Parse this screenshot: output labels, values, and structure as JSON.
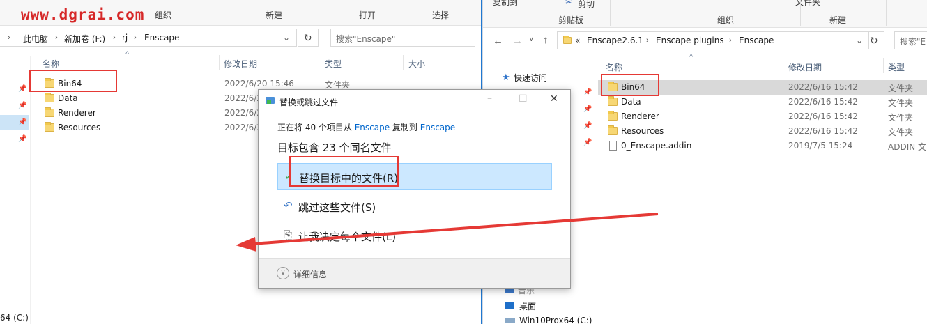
{
  "watermark": "www.dgrai.com",
  "left_window": {
    "ribbon_groups": [
      "组织",
      "新建",
      "打开",
      "选择"
    ],
    "breadcrumbs": [
      "此电脑",
      "新加卷 (F:)",
      "rj",
      "Enscape"
    ],
    "search_placeholder": "搜索\"Enscape\"",
    "columns": {
      "name": "名称",
      "date": "修改日期",
      "type": "类型",
      "size": "大小"
    },
    "files": [
      {
        "name": "Bin64",
        "date": "2022/6/20 15:46",
        "type": "文件夹"
      },
      {
        "name": "Data",
        "date": "2022/6/2",
        "type": ""
      },
      {
        "name": "Renderer",
        "date": "2022/6/2",
        "type": ""
      },
      {
        "name": "Resources",
        "date": "2022/6/2",
        "type": ""
      }
    ],
    "nav_bottom": "64 (C:)"
  },
  "right_window": {
    "ribbon_top": [
      "复制到",
      "剪切",
      "文件夹"
    ],
    "ribbon_groups": [
      "剪贴板",
      "组织",
      "新建"
    ],
    "breadcrumbs_prefix": "«",
    "breadcrumbs": [
      "Enscape2.6.1",
      "Enscape plugins",
      "Enscape"
    ],
    "search_placeholder": "搜索\"E",
    "columns": {
      "name": "名称",
      "date": "修改日期",
      "type": "类型"
    },
    "files": [
      {
        "name": "Bin64",
        "date": "2022/6/16 15:42",
        "type": "文件夹",
        "icon": "folder"
      },
      {
        "name": "Data",
        "date": "2022/6/16 15:42",
        "type": "文件夹",
        "icon": "folder"
      },
      {
        "name": "Renderer",
        "date": "2022/6/16 15:42",
        "type": "文件夹",
        "icon": "folder"
      },
      {
        "name": "Resources",
        "date": "2022/6/16 15:42",
        "type": "文件夹",
        "icon": "folder"
      },
      {
        "name": "0_Enscape.addin",
        "date": "2019/7/5 15:24",
        "type": "ADDIN 文",
        "icon": "file"
      }
    ],
    "nav": {
      "quick_access": "快速访问",
      "music": "音乐",
      "desktop": "桌面",
      "drive": "Win10Prox64 (C:)"
    }
  },
  "dialog": {
    "title": "替换或跳过文件",
    "line1": {
      "prefix": "正在将 40 个项目从 ",
      "src": "Enscape",
      "mid": " 复制到 ",
      "dst": "Enscape"
    },
    "heading": "目标包含 23 个同名文件",
    "options": [
      {
        "label": "替换目标中的文件(R)",
        "icon": "✓"
      },
      {
        "label": "跳过这些文件(S)",
        "icon": "↶"
      },
      {
        "label": "让我决定每个文件(L)",
        "icon": "⎘"
      }
    ],
    "details": "详细信息"
  },
  "colors": {
    "annotation_red": "#e53935",
    "selection_blue": "#cce8ff",
    "link_blue": "#0066cc"
  }
}
